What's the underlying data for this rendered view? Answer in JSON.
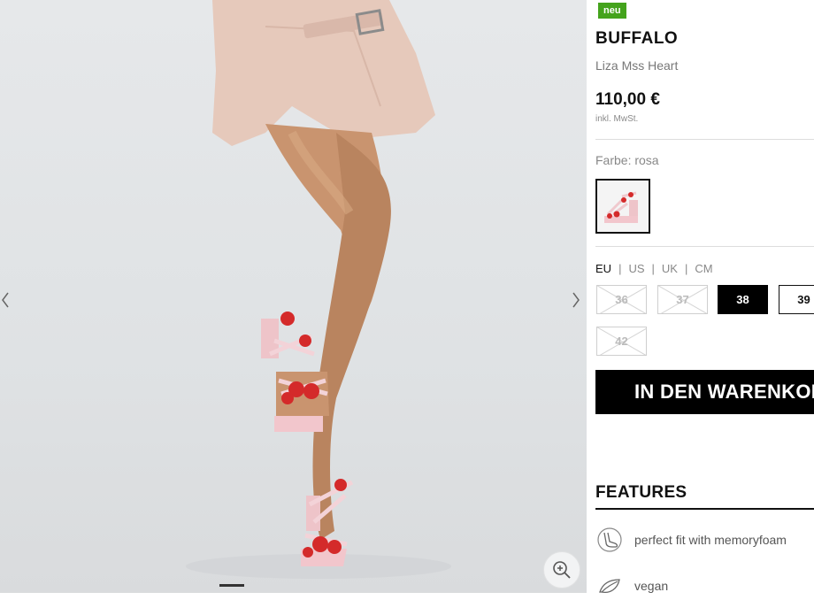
{
  "product": {
    "badge": "neu",
    "brand": "BUFFALO",
    "model": "Liza Mss Heart",
    "price": "110,00 €",
    "tax_note": "inkl. MwSt."
  },
  "color": {
    "label": "Farbe: rosa",
    "swatch_icon": "sandal-thumbnail"
  },
  "size_systems": [
    "EU",
    "US",
    "UK",
    "CM"
  ],
  "size_system_active": "EU",
  "sizes": [
    {
      "label": "36",
      "state": "unavailable"
    },
    {
      "label": "37",
      "state": "unavailable"
    },
    {
      "label": "38",
      "state": "selected"
    },
    {
      "label": "39",
      "state": "available"
    },
    {
      "label": "42",
      "state": "unavailable"
    }
  ],
  "cart_button": "IN DEN WARENKORB",
  "features": {
    "title": "FEATURES",
    "items": [
      {
        "label": "perfect fit with memoryfoam",
        "icon": "foot-icon"
      },
      {
        "label": "vegan",
        "icon": "leaf-icon"
      }
    ]
  },
  "gallery": {
    "prev_icon": "chevron-left-icon",
    "next_icon": "chevron-right-icon",
    "zoom_icon": "zoom-in-icon"
  },
  "colors": {
    "badge_green": "#44a31c",
    "heart_red": "#d42a2a",
    "sandal_pink": "#f2c6cc"
  }
}
